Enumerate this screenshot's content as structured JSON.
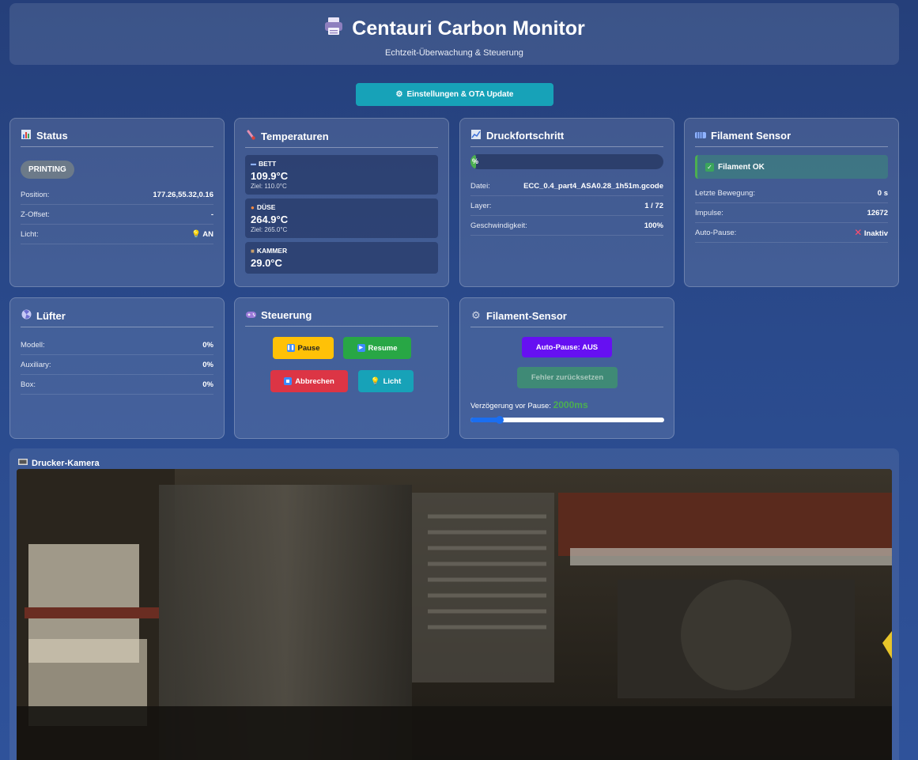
{
  "header": {
    "icon": "printer-icon",
    "title": "Centauri Carbon Monitor",
    "subtitle": "Echtzeit-Überwachung & Steuerung"
  },
  "ota_button": {
    "icon": "gear-icon",
    "label": "Einstellungen & OTA Update"
  },
  "status": {
    "title": "Status",
    "icon": "bar-chart-icon",
    "state": "PRINTING",
    "rows": [
      {
        "label": "Position:",
        "value": "177.26,55.32,0.16"
      },
      {
        "label": "Z-Offset:",
        "value": "-"
      },
      {
        "label": "Licht:",
        "value": "AN",
        "icon": "lightbulb-icon"
      }
    ]
  },
  "temperatures": {
    "title": "Temperaturen",
    "icon": "thermometer-icon",
    "items": [
      {
        "name": "BETT",
        "icon": "bed-icon",
        "value": "109.9°C",
        "target": "Ziel: 110.0°C"
      },
      {
        "name": "DÜSE",
        "icon": "flame-icon",
        "value": "264.9°C",
        "target": "Ziel: 265.0°C"
      },
      {
        "name": "KAMMER",
        "icon": "box-icon",
        "value": "29.0°C"
      }
    ]
  },
  "progress": {
    "title": "Druckfortschritt",
    "icon": "chart-icon",
    "percent_text": "%",
    "percent": 1,
    "rows": [
      {
        "label": "Datei:",
        "value": "ECC_0.4_part4_ASA0.28_1h51m.gcode"
      },
      {
        "label": "Layer:",
        "value": "1 / 72"
      },
      {
        "label": "Geschwindigkeit:",
        "value": "100%"
      }
    ]
  },
  "filament_sensor": {
    "title": "Filament Sensor",
    "icon": "filament-icon",
    "status": "Filament OK",
    "rows": [
      {
        "label": "Letzte Bewegung:",
        "value": "0 s"
      },
      {
        "label": "Impulse:",
        "value": "12672"
      },
      {
        "label": "Auto-Pause:",
        "value": "Inaktiv",
        "icon": "cross-icon"
      }
    ]
  },
  "fans": {
    "title": "Lüfter",
    "icon": "fan-icon",
    "rows": [
      {
        "label": "Modell:",
        "value": "0%"
      },
      {
        "label": "Auxiliary:",
        "value": "0%"
      },
      {
        "label": "Box:",
        "value": "0%"
      }
    ]
  },
  "control": {
    "title": "Steuerung",
    "icon": "gamepad-icon",
    "pause": "Pause",
    "resume": "Resume",
    "cancel": "Abbrechen",
    "light": "Licht"
  },
  "filament_settings": {
    "title": "Filament-Sensor",
    "icon": "gear-icon",
    "auto_pause": "Auto-Pause: AUS",
    "reset": "Fehler zurücksetzen",
    "delay_label": "Verzögerung vor Pause:",
    "delay_value": "2000ms",
    "delay_fraction": 0.15
  },
  "camera": {
    "title": "Drucker-Kamera",
    "icon": "camera-icon"
  },
  "colors": {
    "accent_cyan": "#17a2b8",
    "pause_yellow": "#ffc107",
    "resume_green": "#28a745",
    "cancel_red": "#dc3545",
    "auto_pause_purple": "#6610f2",
    "success_green": "#4caf50"
  }
}
